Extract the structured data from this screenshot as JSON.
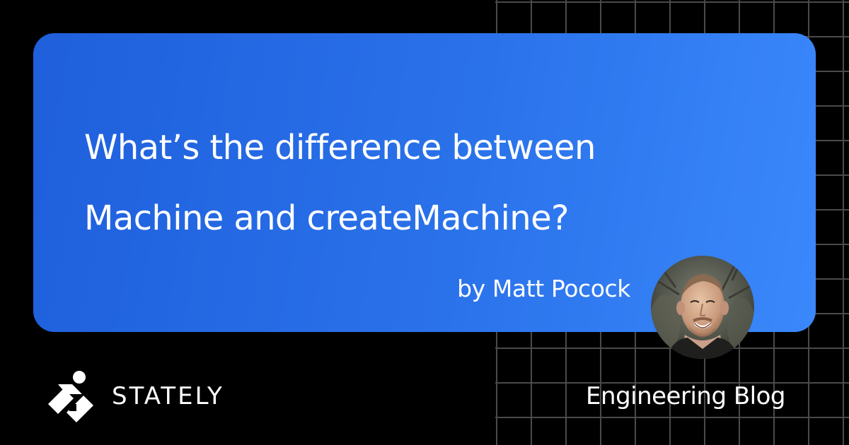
{
  "card": {
    "title_line1": "What’s the difference between",
    "title_line2": "Machine and createMachine?",
    "byline": "by Matt Pocock",
    "gradient_start": "#1f5fdc",
    "gradient_end": "#3a88fb"
  },
  "avatar": {
    "icon": "author-photo"
  },
  "footer": {
    "brand": "STATELY",
    "logo_icon": "stately-logo-icon",
    "section": "Engineering Blog"
  },
  "colors": {
    "background": "#000000",
    "grid": "#4a4a4a",
    "text": "#ffffff"
  }
}
